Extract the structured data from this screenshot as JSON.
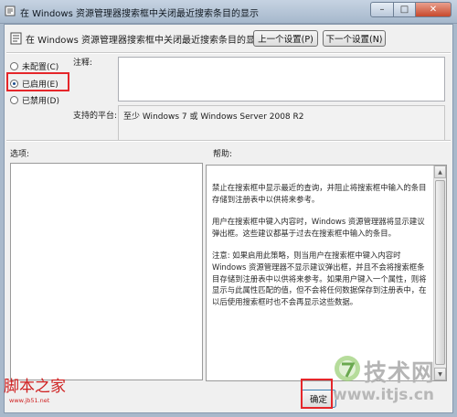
{
  "window": {
    "title": "在 Windows 资源管理器搜索框中关闭最近搜索条目的显示",
    "minimize_glyph": "–",
    "maximize_glyph": "□",
    "close_glyph": "✕"
  },
  "header": {
    "policy_name": "在 Windows 资源管理器搜索框中关闭最近搜索条目的显示",
    "prev_setting_label": "上一个设置(P)",
    "next_setting_label": "下一个设置(N)"
  },
  "state": {
    "options": [
      {
        "label": "未配置(C)",
        "selected": false
      },
      {
        "label": "已启用(E)",
        "selected": true
      },
      {
        "label": "已禁用(D)",
        "selected": false
      }
    ]
  },
  "comment": {
    "label": "注释:",
    "value": ""
  },
  "platform": {
    "label": "支持的平台:",
    "value": "至少 Windows 7 或 Windows Server 2008 R2"
  },
  "options_section": {
    "label": "选项:"
  },
  "help_section": {
    "label": "帮助:",
    "paragraphs": [
      "禁止在搜索框中显示最近的查询，并阻止将搜索框中输入的条目存储到注册表中以供将来参考。",
      "用户在搜索框中键入内容时，Windows 资源管理器将显示建议弹出框。这些建议都基于过去在搜索框中输入的条目。",
      "注意: 如果启用此策略，则当用户在搜索框中键入内容时 Windows 资源管理器不显示建议弹出框，并且不会将搜索框条目存储到注册表中以供将来参考。如果用户键入一个属性，则将显示与此属性匹配的值，但不会将任何数据保存到注册表中，在以后使用搜索框时也不会再显示这些数据。"
    ],
    "scroll_up_glyph": "▲",
    "scroll_down_glyph": "▼"
  },
  "footer": {
    "ok_label": "确定"
  },
  "watermarks": {
    "left_text": "脚本之家",
    "left_url": "www.jb51.net",
    "right_text": "技术网",
    "right_url": "www.itjs.cn"
  },
  "colors": {
    "highlight": "#e5262a",
    "title_bar": "#b3c3d6"
  }
}
